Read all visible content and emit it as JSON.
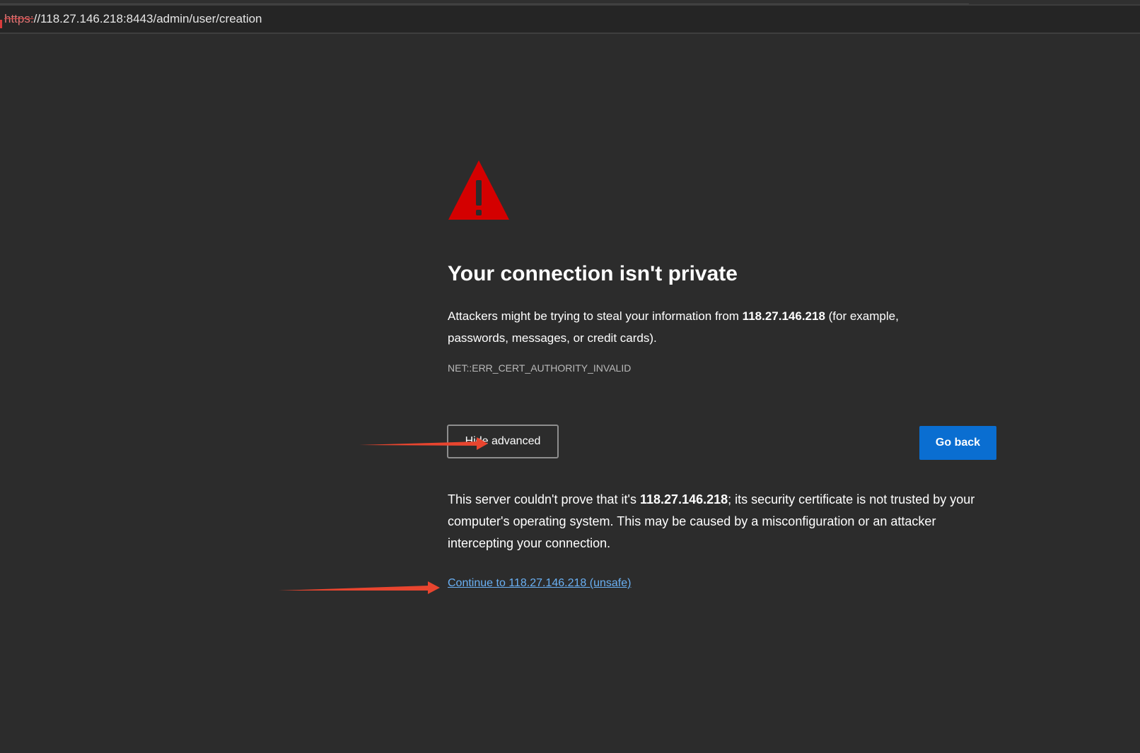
{
  "browser": {
    "url_scheme": "https:",
    "url_rest": "//118.27.146.218:8443/admin/user/creation"
  },
  "icons": {
    "warning": "warning-triangle-icon"
  },
  "interstitial": {
    "title": "Your connection isn't private",
    "desc_before": "Attackers might be trying to steal your information from ",
    "host": "118.27.146.218",
    "desc_after": " (for example, passwords, messages, or credit cards).",
    "error_code": "NET::ERR_CERT_AUTHORITY_INVALID",
    "advanced_button": "Hide advanced",
    "go_back_button": "Go back",
    "details_before": "This server couldn't prove that it's ",
    "details_after": "; its security certificate is not trusted by your computer's operating system. This may be caused by a misconfiguration or an attacker intercepting your connection.",
    "continue_link": "Continue to 118.27.146.218 (unsafe)"
  },
  "colors": {
    "background": "#2c2c2c",
    "warning_red": "#d40000",
    "primary_button": "#0a6ed1",
    "link": "#6ab0f3",
    "annotation_arrow": "#e8452f"
  }
}
